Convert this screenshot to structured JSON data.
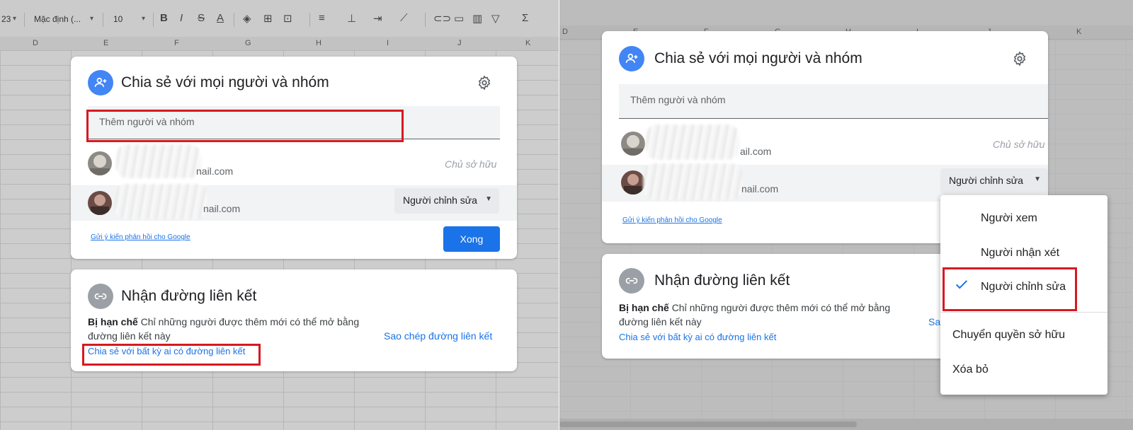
{
  "left_toolbar": {
    "zoom_fragment": "23",
    "font_name": "Mặc định (...",
    "font_size": "10"
  },
  "left_columns": [
    "D",
    "E",
    "F",
    "G",
    "H",
    "I",
    "J",
    "K"
  ],
  "right_columns": [
    "D",
    "E",
    "F",
    "G",
    "H",
    "I",
    "J",
    "K"
  ],
  "share_dialog": {
    "title": "Chia sẻ với mọi người và nhóm",
    "input_placeholder": "Thêm người và nhóm",
    "people": [
      {
        "email_suffix": "nail.com",
        "role": "Chủ sở hữu"
      },
      {
        "email_suffix": "nail.com",
        "role": "Người chỉnh sửa"
      }
    ],
    "feedback_link": "Gửi ý kiến phản hồi cho Google",
    "done_label": "Xong"
  },
  "share_dialog_right": {
    "people": [
      {
        "email_suffix": "ail.com",
        "role": "Chủ sở hữu"
      },
      {
        "email_suffix": "nail.com",
        "role": "Người chỉnh sửa"
      }
    ]
  },
  "link_dialog": {
    "title": "Nhận đường liên kết",
    "restricted_label": "Bị hạn chế",
    "description": "Chỉ những người được thêm mới có thể mở bằng đường liên kết này",
    "share_anyone_link": "Chia sẻ với bất kỳ ai có đường liên kết",
    "copy_link_label": "Sao chép đường liên kết",
    "copy_link_truncated": "Sa"
  },
  "role_menu": {
    "items": [
      "Người xem",
      "Người nhận xét",
      "Người chỉnh sửa",
      "Chuyển quyền sở hữu",
      "Xóa bỏ"
    ],
    "selected": "Người chỉnh sửa"
  },
  "colors": {
    "accent_blue": "#1a73e8",
    "icon_blue": "#4285f4",
    "highlight_red": "#d71920"
  }
}
